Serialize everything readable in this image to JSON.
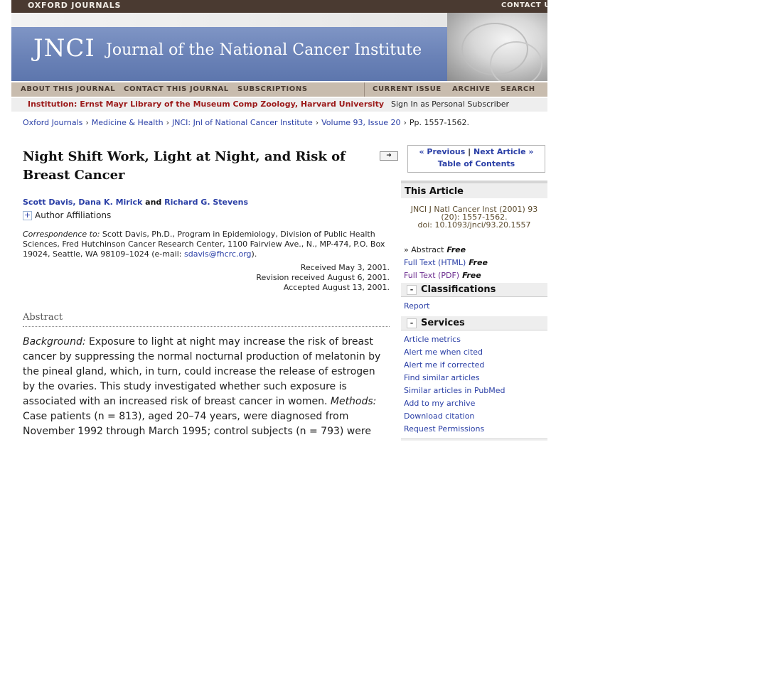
{
  "header": {
    "publisher": "OXFORD JOURNALS",
    "contact": "CONTACT US",
    "journal_abbrev": "JNCI",
    "journal_title": "Journal of the National Cancer Institute"
  },
  "nav": {
    "about": "ABOUT THIS JOURNAL",
    "contact": "CONTACT THIS JOURNAL",
    "subscriptions": "SUBSCRIPTIONS",
    "current": "CURRENT ISSUE",
    "archive": "ARCHIVE",
    "search": "SEARCH"
  },
  "institution": {
    "label": "Institution: Ernst Mayr Library of the Museum Comp Zoology, Harvard University",
    "signin": "Sign In as Personal Subscriber"
  },
  "breadcrumb": {
    "items": [
      "Oxford Journals",
      "Medicine & Health",
      "JNCI: Jnl of National Cancer Institute",
      "Volume 93, Issue 20"
    ],
    "last": "Pp. 1557-1562."
  },
  "article": {
    "title": "Night Shift Work, Light at Night, and Risk of Breast Cancer",
    "authors": {
      "a1": "Scott Davis",
      "a2": "Dana K. Mirick",
      "and": "and",
      "a3": "Richard G. Stevens"
    },
    "affiliations_label": "Author Affiliations",
    "correspondence": {
      "label": "Correspondence to:",
      "text": "Scott Davis, Ph.D., Program in Epidemiology, Division of Public Health Sciences, Fred Hutchinson Cancer Research Center, 1100 Fairview Ave., N., MP-474, P.O. Box 19024, Seattle, WA 98109–1024 (e-mail:",
      "email": "sdavis@fhcrc.org",
      "tail": ")."
    },
    "dates": {
      "received": "Received May 3, 2001.",
      "revised": "Revision received August 6, 2001.",
      "accepted": "Accepted August 13, 2001."
    },
    "abstract_heading": "Abstract",
    "abstract": {
      "background_label": "Background:",
      "background_text": "Exposure to light at night may increase the risk of breast cancer by suppressing the normal nocturnal production of melatonin by the pineal gland, which, in turn, could increase the release of estrogen by the ovaries. This study investigated whether such exposure is associated with an increased risk of breast cancer in women.",
      "methods_label": "Methods:",
      "methods_text": "Case patients (n = 813), aged 20–74 years, were diagnosed from November 1992 through March 1995; control subjects (n = 793) were"
    }
  },
  "sidebar": {
    "prev": "« Previous",
    "next": "Next Article »",
    "toc": "Table of Contents",
    "this_article": "This Article",
    "citation_line1": "JNCI J Natl Cancer Inst (2001) 93",
    "citation_line2": "(20): 1557-1562.",
    "doi": "doi: 10.1093/jnci/93.20.1557",
    "abstract_link": "» Abstract",
    "fulltext_html": "Full Text (HTML)",
    "fulltext_pdf": "Full Text (PDF)",
    "free": "Free",
    "classifications": "Classifications",
    "report": "Report",
    "services": "Services",
    "service_links": [
      "Article metrics",
      "Alert me when cited",
      "Alert me if corrected",
      "Find similar articles",
      "Similar articles in PubMed",
      "Add to my archive",
      "Download citation",
      "Request Permissions"
    ]
  }
}
